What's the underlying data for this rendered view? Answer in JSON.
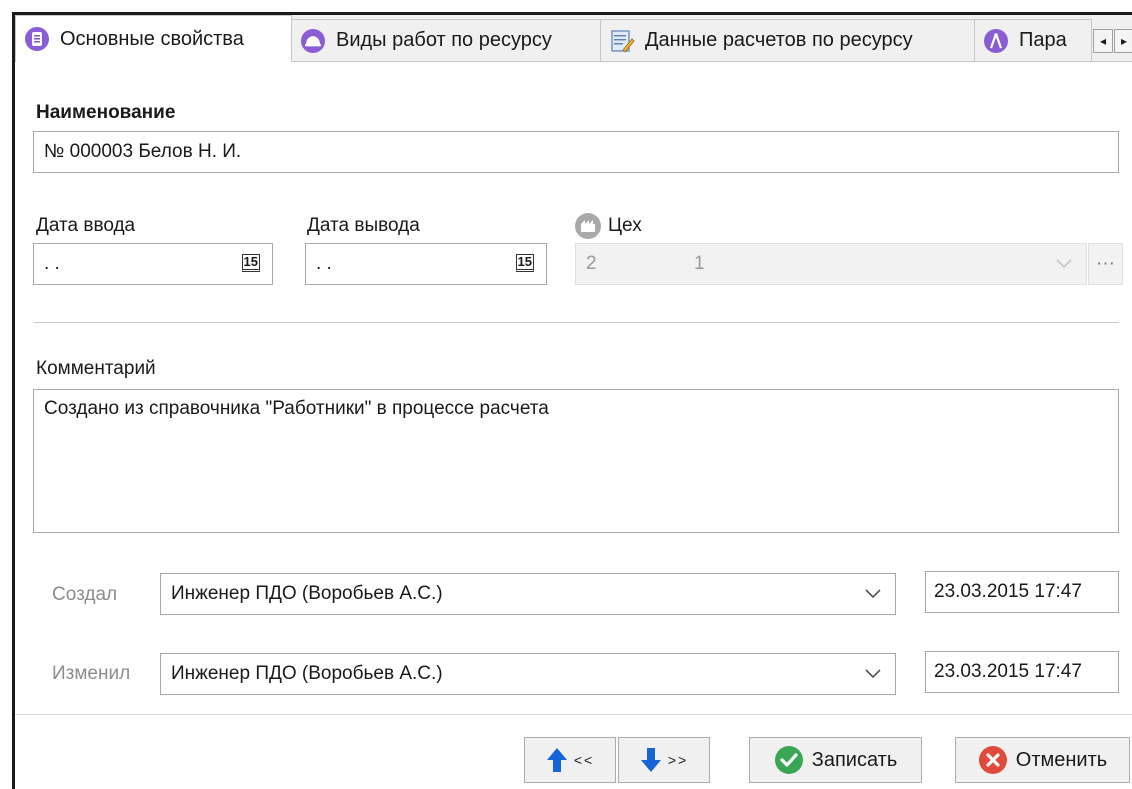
{
  "tabs": [
    {
      "label": "Основные свойства",
      "icon": "document-list-icon",
      "active": true
    },
    {
      "label": "Виды работ по ресурсу",
      "icon": "hard-hat-icon",
      "active": false
    },
    {
      "label": "Данные расчетов по ресурсу",
      "icon": "notepad-pencil-icon",
      "active": false
    },
    {
      "label": "Пара",
      "icon": "compass-icon",
      "active": false
    }
  ],
  "form": {
    "name_label": "Наименование",
    "name_value": "№ 000003 Белов Н. И.",
    "date_in_label": "Дата ввода",
    "date_in_value": ". .",
    "date_out_label": "Дата вывода",
    "date_out_value": ". .",
    "calendar_glyph": "15",
    "workshop_label": "Цех",
    "workshop_code": "2",
    "workshop_value": "1",
    "ellipsis": "···",
    "comment_label": "Комментарий",
    "comment_value": "Создано из справочника \"Работники\" в процессе расчета",
    "created_label": "Создал",
    "created_by": "Инженер ПДО (Воробьев А.С.)",
    "created_at": "23.03.2015 17:47",
    "modified_label": "Изменил",
    "modified_by": "Инженер ПДО (Воробьев А.С.)",
    "modified_at": "23.03.2015 17:47"
  },
  "buttons": {
    "prev": "<<",
    "next": ">>",
    "save": "Записать",
    "cancel": "Отменить"
  },
  "colors": {
    "accent_purple": "#8a5cd6",
    "arrow_blue": "#1565d8",
    "save_green": "#3aa655",
    "cancel_red": "#e04a3a"
  }
}
